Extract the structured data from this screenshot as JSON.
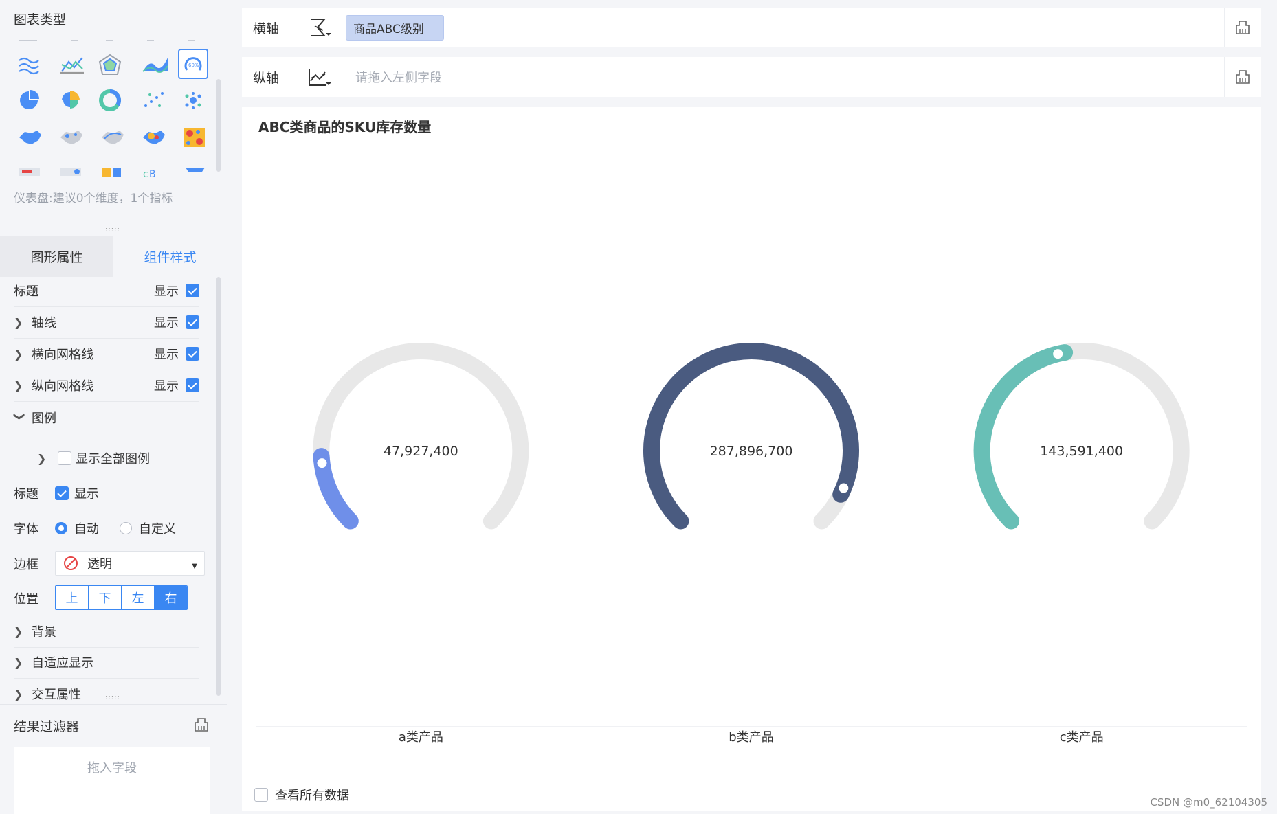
{
  "sidebar": {
    "title": "图表类型",
    "hint": "仪表盘:建议0个维度，1个指标",
    "tabs": [
      "图形属性",
      "组件样式"
    ],
    "rows": [
      {
        "label": "标题",
        "show": "显示"
      },
      {
        "label": "轴线",
        "show": "显示"
      },
      {
        "label": "横向网格线",
        "show": "显示"
      },
      {
        "label": "纵向网格线",
        "show": "显示"
      },
      {
        "label": "图例"
      }
    ],
    "legend": {
      "show_all": "显示全部图例",
      "title_label": "标题",
      "title_show": "显示",
      "font_label": "字体",
      "font_auto": "自动",
      "font_custom": "自定义",
      "border_label": "边框",
      "border_value": "透明",
      "position_label": "位置",
      "positions": [
        "上",
        "下",
        "左",
        "右"
      ],
      "position_selected": "右"
    },
    "more_rows": [
      "背景",
      "自适应显示",
      "交互属性"
    ],
    "filter_title": "结果过滤器",
    "filter_placeholder": "拖入字段"
  },
  "axes": {
    "x_label": "横轴",
    "x_field": "商品ABC级别",
    "y_label": "纵轴",
    "y_placeholder": "请拖入左侧字段"
  },
  "chart_data": {
    "type": "gauge",
    "title": "ABC类商品的SKU库存数量",
    "categories": [
      "a类产品",
      "b类产品",
      "c类产品"
    ],
    "values": [
      47927400,
      287896700,
      143591400
    ],
    "value_labels": [
      "47,927,400",
      "287,896,700",
      "143,591,400"
    ],
    "max": 287896700,
    "colors": [
      "#6f8fe9",
      "#4a5b80",
      "#68bfb6"
    ],
    "track_color": "#e8e8e8"
  },
  "footer": {
    "view_all": "查看所有数据",
    "watermark": "CSDN @m0_62104305"
  }
}
